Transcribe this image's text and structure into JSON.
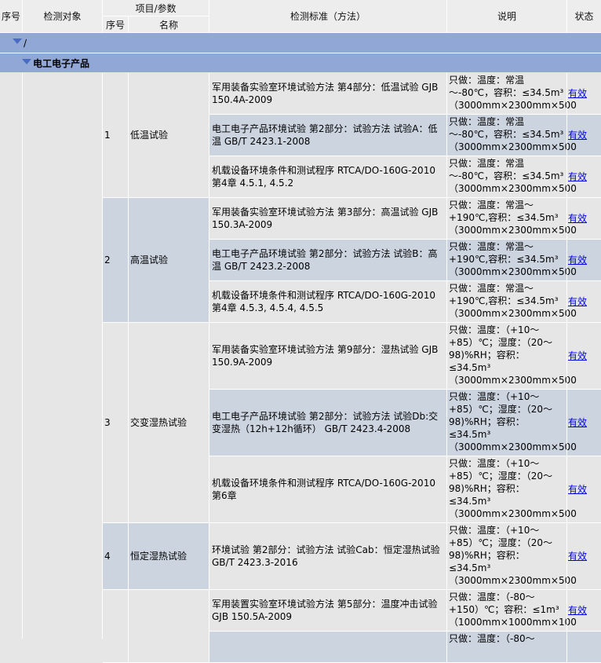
{
  "header": {
    "seq": "序号",
    "object": "检测对象",
    "param_group": "项目/参数",
    "param_seq": "序号",
    "param_name": "名称",
    "standard": "检测标准（方法）",
    "note": "说明",
    "status": "状态"
  },
  "groups": [
    {
      "label": "/"
    },
    {
      "label": "电工电子产品"
    }
  ],
  "items": [
    {
      "seq": "1",
      "name": "低温试验",
      "rows": [
        {
          "standard": "军用装备实验室环境试验方法 第4部分：低温试验 GJB 150.4A-2009",
          "note": [
            "只做：温度：常温",
            "～-80℃，容积：≤34.5m³",
            "（3000mm×2300mm×500"
          ],
          "status": "有效"
        },
        {
          "standard": "电工电子产品环境试验 第2部分：试验方法 试验A：低温 GB/T 2423.1-2008",
          "note": [
            "只做：温度：常温",
            "～-80℃，容积：≤34.5m³",
            "（3000mm×2300mm×500"
          ],
          "status": "有效"
        },
        {
          "standard": "机载设备环境条件和测试程序 RTCA/DO-160G-2010 第4章 4.5.1, 4.5.2",
          "note": [
            "只做：温度：常温",
            "～-80℃，容积：≤34.5m³",
            "（3000mm×2300mm×500"
          ],
          "status": "有效"
        }
      ]
    },
    {
      "seq": "2",
      "name": "高温试验",
      "rows": [
        {
          "standard": "军用装备实验室环境试验方法 第3部分：高温试验 GJB 150.3A-2009",
          "note": [
            "只做：温度：常温～",
            "+190℃,容积：≤34.5m³",
            "（3000mm×2300mm×500"
          ],
          "status": "有效"
        },
        {
          "standard": "电工电子产品环境试验 第2部分：试验方法 试验B：高温 GB/T 2423.2-2008",
          "note": [
            "只做：温度：常温～",
            "+190℃,容积：≤34.5m³",
            "（3000mm×2300mm×500"
          ],
          "status": "有效"
        },
        {
          "standard": "机载设备环境条件和测试程序 RTCA/DO-160G-2010 第4章 4.5.3, 4.5.4, 4.5.5",
          "note": [
            "只做：温度：常温～",
            "+190℃,容积：≤34.5m³",
            "（3000mm×2300mm×500"
          ],
          "status": "有效"
        }
      ]
    },
    {
      "seq": "3",
      "name": "交变湿热试验",
      "rows": [
        {
          "standard": "军用装备实验室环境试验方法 第9部分：湿热试验 GJB 150.9A-2009",
          "note": [
            "只做：温度：（+10～",
            "+85）℃；湿度：（20～",
            "98)%RH；容积：",
            "≤34.5m³",
            "（3000mm×2300mm×500"
          ],
          "status": "有效"
        },
        {
          "standard": "电工电子产品环境试验 第2部分：试验方法 试验Db:交变湿热（12h+12h循环） GB/T 2423.4-2008",
          "note": [
            "只做：温度：（+10～",
            "+85）℃；湿度：（20～",
            "98)%RH；容积：",
            "≤34.5m³",
            "（3000mm×2300mm×500"
          ],
          "status": "有效"
        },
        {
          "standard": "机载设备环境条件和测试程序 RTCA/DO-160G-2010 第6章",
          "note": [
            "只做：温度：（+10～",
            "+85）℃；湿度：（20～",
            "98)%RH；容积：",
            "≤34.5m³",
            "（3000mm×2300mm×500"
          ],
          "status": "有效"
        }
      ]
    },
    {
      "seq": "4",
      "name": "恒定湿热试验",
      "rows": [
        {
          "standard": "环境试验 第2部分：试验方法 试验Cab：恒定湿热试验 GB/T 2423.3-2016",
          "note": [
            "只做：温度：（+10～",
            "+85）℃；湿度：（20～",
            "98)%RH；容积：",
            "≤34.5m³",
            "（3000mm×2300mm×500"
          ],
          "status": "有效"
        }
      ]
    },
    {
      "seq": "",
      "name": "",
      "rows": [
        {
          "standard": "军用装置实验室环境试验方法 第5部分：温度冲击试验 GJB 150.5A-2009",
          "note": [
            "只做：温度：（-80～",
            "+150）℃；容积：≤1m³",
            "（1000mm×1000mm×100"
          ],
          "status": "有效"
        },
        {
          "standard": "",
          "note": [
            "只做：温度：（-80～"
          ],
          "status": ""
        }
      ]
    }
  ]
}
